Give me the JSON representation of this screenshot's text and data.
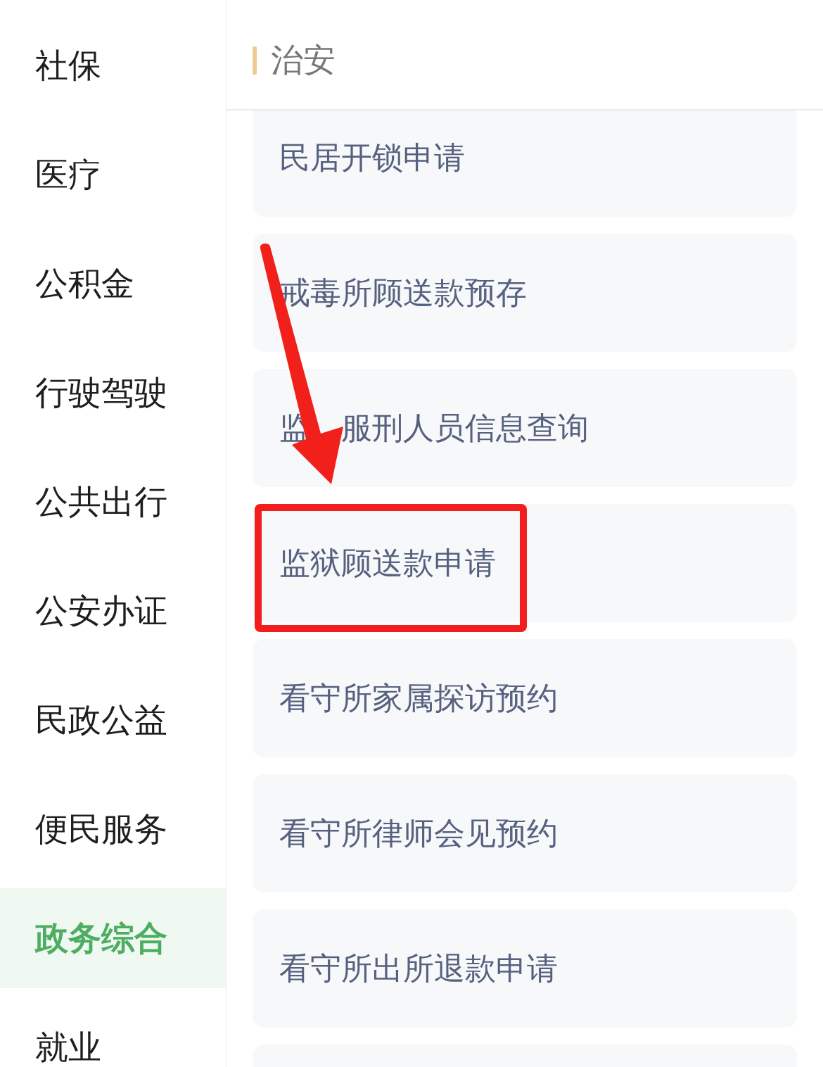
{
  "sidebar": {
    "items": [
      {
        "label": "社保",
        "selected": false
      },
      {
        "label": "医疗",
        "selected": false
      },
      {
        "label": "公积金",
        "selected": false
      },
      {
        "label": "行驶驾驶",
        "selected": false
      },
      {
        "label": "公共出行",
        "selected": false
      },
      {
        "label": "公安办证",
        "selected": false
      },
      {
        "label": "民政公益",
        "selected": false
      },
      {
        "label": "便民服务",
        "selected": false
      },
      {
        "label": "政务综合",
        "selected": true
      },
      {
        "label": "就业",
        "selected": false
      }
    ]
  },
  "section": {
    "title": "治安",
    "items": [
      {
        "label": "民居开锁申请",
        "highlighted": false
      },
      {
        "label": "戒毒所顾送款预存",
        "highlighted": false
      },
      {
        "label": "监　服刑人员信息查询",
        "highlighted": false
      },
      {
        "label": "监狱顾送款申请",
        "highlighted": true
      },
      {
        "label": "看守所家属探访预约",
        "highlighted": false
      },
      {
        "label": "看守所律师会见预约",
        "highlighted": false
      },
      {
        "label": "看守所出所退款申请",
        "highlighted": false
      }
    ]
  }
}
